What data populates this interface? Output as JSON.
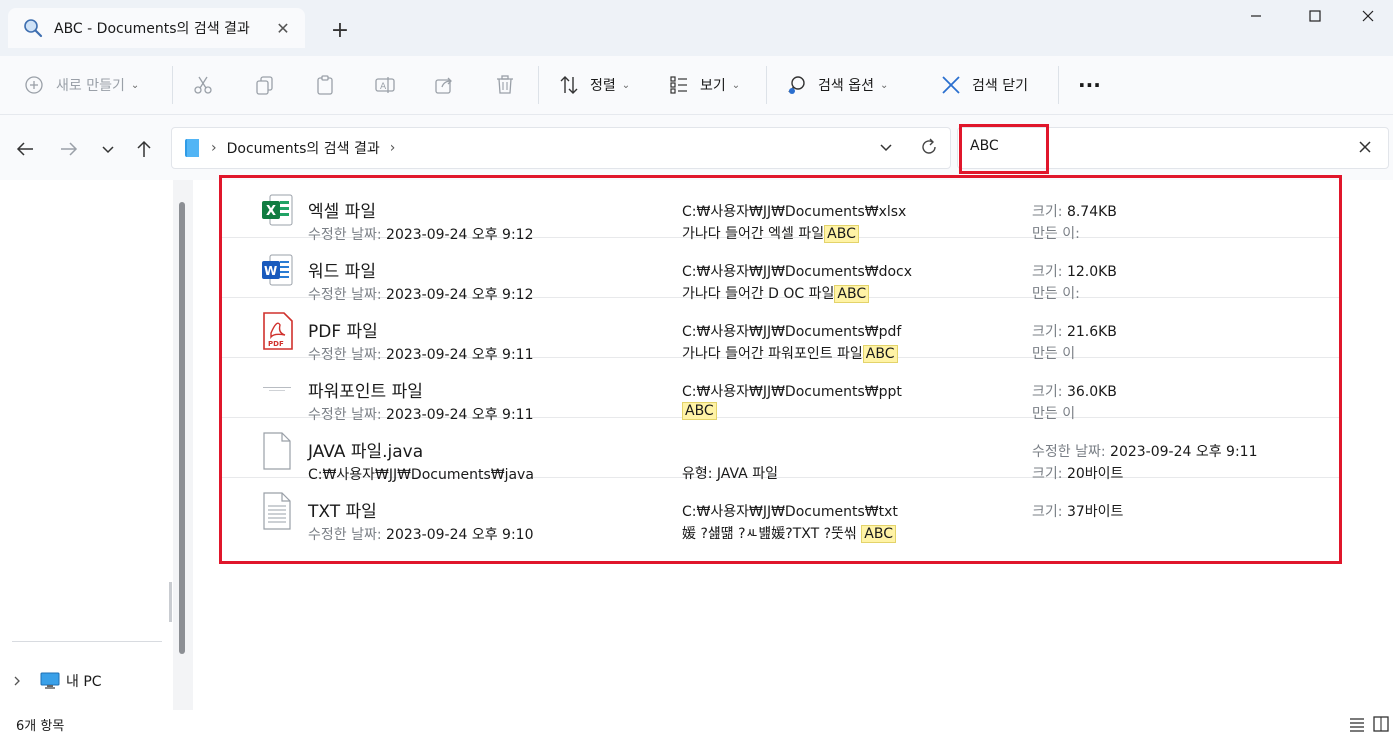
{
  "window": {
    "tab_title": "ABC - Documents의 검색 결과",
    "new_tab_symbol": "+",
    "close_symbol": "✕"
  },
  "toolbar": {
    "new_label": "새로 만들기",
    "sort_label": "정렬",
    "view_label": "보기",
    "search_options_label": "검색 옵션",
    "close_search_label": "검색 닫기",
    "more_symbol": "···"
  },
  "nav": {
    "breadcrumb_separator": "›",
    "location": "Documents의 검색 결과"
  },
  "search": {
    "query": "ABC"
  },
  "sidebar": {
    "pc_label": "내 PC"
  },
  "results": [
    {
      "name": "엑셀 파일",
      "meta_label": "수정한 날짜:",
      "meta_value": "2023-09-24 오후 9:12",
      "path": "C:₩사용자₩JJ₩Documents₩xlsx",
      "snippet": "가나다 들어간 엑셀 파일",
      "match": "ABC",
      "r1_label": "크기:",
      "r1_value": "8.74KB",
      "r2_label": "만든 이:",
      "r2_value": "",
      "icon": "excel-file-icon"
    },
    {
      "name": "워드 파일",
      "meta_label": "수정한 날짜:",
      "meta_value": "2023-09-24 오후 9:12",
      "path": "C:₩사용자₩JJ₩Documents₩docx",
      "snippet": "가나다 들어간 D OC 파일",
      "match": "ABC",
      "r1_label": "크기:",
      "r1_value": "12.0KB",
      "r2_label": "만든 이:",
      "r2_value": "",
      "icon": "word-file-icon"
    },
    {
      "name": "PDF 파일",
      "meta_label": "수정한 날짜:",
      "meta_value": "2023-09-24 오후 9:11",
      "path": "C:₩사용자₩JJ₩Documents₩pdf",
      "snippet": "가나다 들어간 파워포인트 파일",
      "match": "ABC",
      "r1_label": "크기:",
      "r1_value": "21.6KB",
      "r2_label": "만든 이",
      "r2_value": "",
      "icon": "pdf-file-icon"
    },
    {
      "name": "파워포인트 파일",
      "meta_label": "수정한 날짜:",
      "meta_value": "2023-09-24 오후 9:11",
      "path": "C:₩사용자₩JJ₩Documents₩ppt",
      "snippet": "",
      "match": "ABC",
      "r1_label": "크기:",
      "r1_value": "36.0KB",
      "r2_label": "만든 이",
      "r2_value": "",
      "icon": "powerpoint-thumbnail-icon"
    },
    {
      "name": "JAVA 파일.java",
      "meta_label": "",
      "meta_value": "C:₩사용자₩JJ₩Documents₩java",
      "path": "",
      "snippet": "유형: JAVA 파일",
      "match": "",
      "r1_label": "수정한 날짜:",
      "r1_value": "2023-09-24 오후 9:11",
      "r2_label": "크기:",
      "r2_value": "20바이트",
      "icon": "generic-file-icon"
    },
    {
      "name": "TXT 파일",
      "meta_label": "수정한 날짜:",
      "meta_value": "2023-09-24 오후 9:10",
      "path": "C:₩사용자₩JJ₩Documents₩txt",
      "snippet": "媛 ?섎떎 ?ㅻ뱶媛?TXT ?뚯씪",
      "match": "ABC",
      "r1_label": "크기:",
      "r1_value": "37바이트",
      "r2_label": "",
      "r2_value": "",
      "icon": "text-file-icon"
    }
  ],
  "status": {
    "item_count": "6개 항목"
  },
  "colors": {
    "highlight_border": "#e0162b",
    "match_highlight": "#fff3a6"
  }
}
